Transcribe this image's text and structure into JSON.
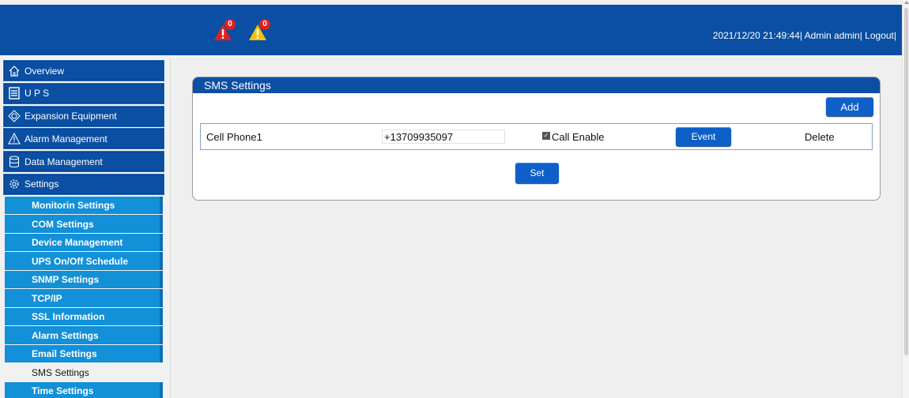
{
  "header": {
    "alarms": [
      {
        "icon": "red-alarm-triangle-icon",
        "count": "0",
        "color": "#e0201f"
      },
      {
        "icon": "yellow-alarm-triangle-icon",
        "count": "0",
        "color": "#f4c20d"
      }
    ],
    "datetime": "2021/12/20 21:49:44|",
    "user": "Admin admin|",
    "logout": "Logout|"
  },
  "sidebar": {
    "items": [
      {
        "label": "Overview",
        "icon": "home-icon"
      },
      {
        "label": "U P S",
        "icon": "server-icon"
      },
      {
        "label": "Expansion Equipment",
        "icon": "expansion-icon"
      },
      {
        "label": "Alarm Management",
        "icon": "warning-icon"
      },
      {
        "label": "Data Management",
        "icon": "database-icon"
      },
      {
        "label": "Settings",
        "icon": "gear-icon"
      }
    ],
    "subitems": [
      "Monitorin Settings",
      "COM Settings",
      "Device Management",
      "UPS On/Off Schedule",
      "SNMP Settings",
      "TCP/IP",
      "SSL Information",
      "Alarm Settings",
      "Email Settings",
      "SMS Settings",
      "Time Settings"
    ],
    "active_subitem": "SMS Settings"
  },
  "panel": {
    "title": "SMS Settings",
    "add_label": "Add",
    "set_label": "Set",
    "rows": [
      {
        "name": "Cell Phone1",
        "phone": "+13709935097",
        "call_enable_label": "Call Enable",
        "call_enable_checked": true,
        "event_label": "Event",
        "delete_label": "Delete"
      }
    ]
  },
  "colors": {
    "header_bg": "#0a4fa3",
    "submenu_bg": "#1290d8",
    "button_bg": "#0f5fc9"
  }
}
